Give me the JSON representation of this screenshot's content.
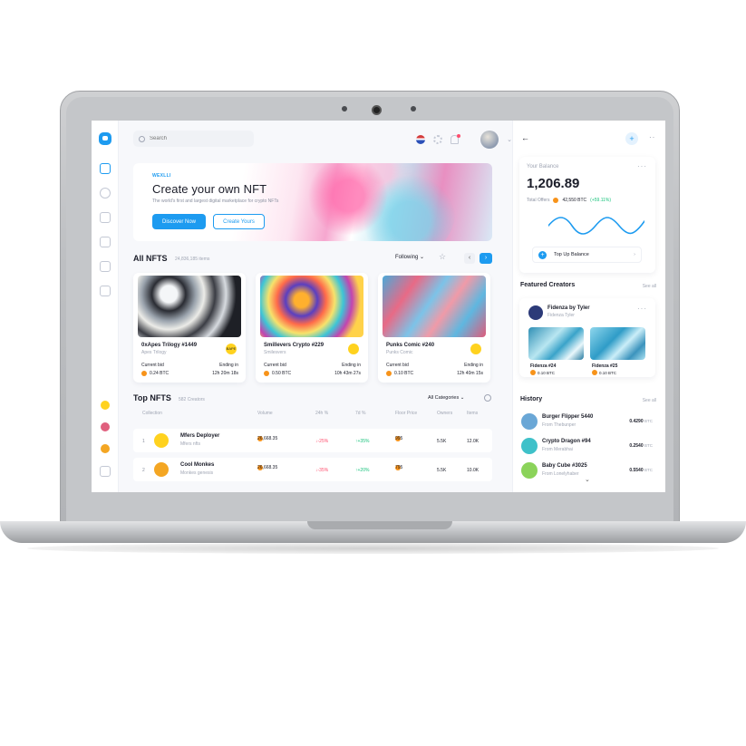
{
  "header": {
    "search_placeholder": "Search"
  },
  "hero": {
    "brand": "WEXLLI",
    "title": "Create your own NFT",
    "subtitle": "The world's first and largest digital marketplace for crypto NFTs",
    "primary_button": "Discover Now",
    "secondary_button": "Create Yours"
  },
  "all_nfts": {
    "title": "All NFTS",
    "count": "24,836,185 items",
    "filter": "Following",
    "cards": [
      {
        "name": "0xApes Trilogy #1449",
        "collection": "Apes Trilogy",
        "badge": "BAPE",
        "bid_label": "Current bid",
        "bid_value": "0.24 BTC",
        "end_label": "Ending in",
        "end_value": "12h 20m 18s"
      },
      {
        "name": "Smillevers Crypto #229",
        "collection": "Smilesvers",
        "badge": "",
        "bid_label": "Current bid",
        "bid_value": "0.50 BTC",
        "end_label": "Ending in",
        "end_value": "10h 43m 27s"
      },
      {
        "name": "Punks Comic #240",
        "collection": "Punks Comic",
        "badge": "",
        "bid_label": "Current bid",
        "bid_value": "0.10 BTC",
        "end_label": "Ending in",
        "end_value": "12h 40m 15s"
      }
    ]
  },
  "top_nfts": {
    "title": "Top NFTS",
    "count": "582 Creators",
    "filter": "All Categories",
    "columns": [
      "Collection",
      "Volume",
      "24h %",
      "7d %",
      "Floor Price",
      "Owners",
      "Items"
    ],
    "rows": [
      {
        "rank": "1",
        "name": "Mfers Deployer",
        "sub": "Mfers nfts",
        "volume": "26,668.35",
        "d24": "-25%",
        "d7": "+35%",
        "floor": "995",
        "owners": "5.5K",
        "items": "12.0K"
      },
      {
        "rank": "2",
        "name": "Cool Monkes",
        "sub": "Monkes genesis",
        "volume": "26,668.35",
        "d24": "-35%",
        "d7": "+20%",
        "floor": "795",
        "owners": "5.5K",
        "items": "10.0K"
      }
    ]
  },
  "balance": {
    "label": "Your Balance",
    "value": "1,206.89",
    "offers_label": "Total Offers",
    "offers_btc": "42,550 BTC",
    "offers_pct": "(+59.11%)",
    "topup": "Top Up Balance"
  },
  "featured": {
    "title": "Featured Creators",
    "see_all": "See all",
    "creator_name": "Fidenza by Tyler",
    "creator_sub": "Fidenza Tyler",
    "items": [
      {
        "name": "Fidenza #24",
        "value": "0.10 BTC"
      },
      {
        "name": "Fidenza #25",
        "value": "0.10 BTC"
      }
    ]
  },
  "history": {
    "title": "History",
    "see_all": "See all",
    "items": [
      {
        "name": "Burger Flipper 5440",
        "sub": "From Thebunper",
        "value": "0.4290",
        "unit": "BTC"
      },
      {
        "name": "Crypto Dragon #94",
        "sub": "From Merabhai",
        "value": "0.2540",
        "unit": "BTC"
      },
      {
        "name": "Baby Cube #3025",
        "sub": "From Lonelyhaber",
        "value": "0.5540",
        "unit": "BTC"
      }
    ]
  },
  "colors": {
    "accent": "#1d9bf0",
    "positive": "#19c37d",
    "negative": "#ff4d6d",
    "btc": "#f7931a"
  }
}
